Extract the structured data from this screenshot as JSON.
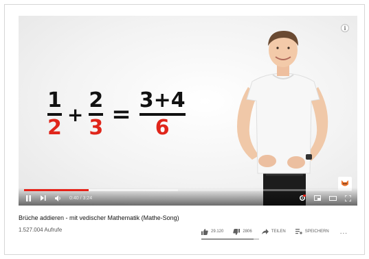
{
  "video": {
    "title": "Brüche addieren - mit vedischer Mathematik (Mathe-Song)",
    "views": "1.527.004 Aufrufe",
    "time": "0:40 / 3:24",
    "progress_fraction": 0.198,
    "formula": {
      "frac1_num": "1",
      "frac1_den": "2",
      "plus": "+",
      "frac2_num": "2",
      "frac2_den": "3",
      "equals": "=",
      "result_num": "3+4",
      "result_den": "6"
    }
  },
  "actions": {
    "likes": "29.120",
    "dislikes": "2806",
    "share_label": "TEILEN",
    "save_label": "SPEICHERN",
    "more_label": "..."
  },
  "icons": {
    "play_pause": "pause-icon",
    "next": "next-icon",
    "volume": "volume-icon",
    "settings": "settings-icon",
    "miniplayer": "miniplayer-icon",
    "theater": "theater-icon",
    "fullscreen": "fullscreen-icon",
    "info": "info-icon"
  },
  "colors": {
    "progress": "#e62117",
    "denominator": "#e0261b"
  }
}
